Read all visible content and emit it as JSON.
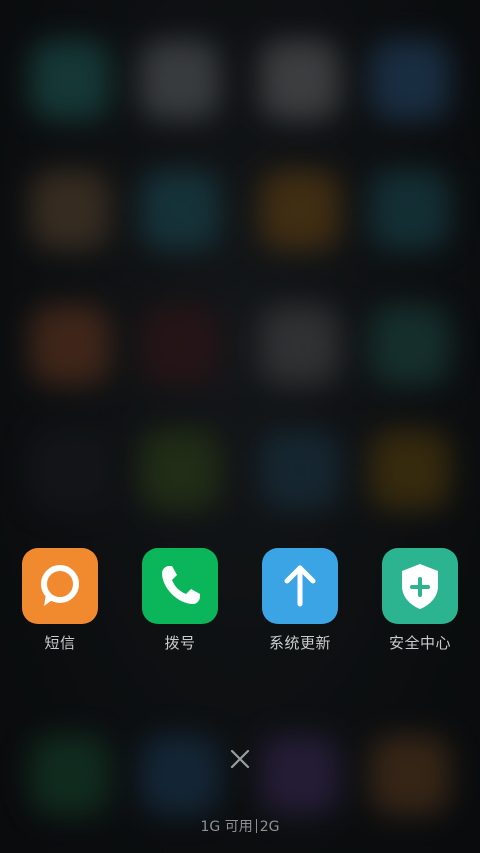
{
  "recent_apps": [
    {
      "label": "短信",
      "icon": "message-bubble-icon",
      "color": "#f1892e"
    },
    {
      "label": "拨号",
      "icon": "phone-handset-icon",
      "color": "#0bb55a"
    },
    {
      "label": "系统更新",
      "icon": "arrow-up-icon",
      "color": "#3aa4e4"
    },
    {
      "label": "安全中心",
      "icon": "shield-plus-icon",
      "color": "#2bb48f"
    }
  ],
  "close_all": {
    "icon": "close-icon"
  },
  "memory": {
    "available": "1G 可用",
    "total": "2G"
  }
}
